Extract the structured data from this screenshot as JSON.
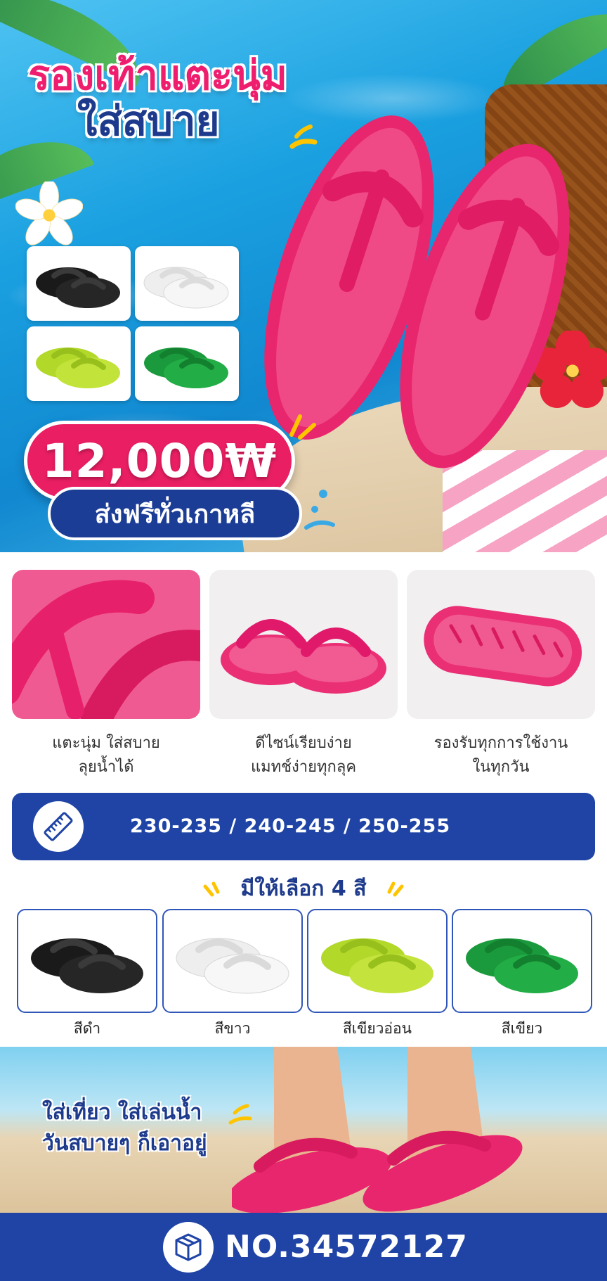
{
  "hero": {
    "title_line1": "รองเท้าแตะนุ่ม",
    "title_line2": "ใส่สบาย",
    "price": "12,000₩",
    "shipping": "ส่งฟรีทั่วเกาหลี"
  },
  "features": [
    {
      "line1": "แตะนุ่ม ใส่สบาย",
      "line2": "ลุยน้ำได้"
    },
    {
      "line1": "ดีไซน์เรียบง่าย",
      "line2": "แมทช์ง่ายทุกลุค"
    },
    {
      "line1": "รองรับทุกการใช้งาน",
      "line2": "ในทุกวัน"
    }
  ],
  "sizes": {
    "text": "230-235  /  240-245  /  250-255",
    "icon": "ruler-icon"
  },
  "colors": {
    "heading": "มีให้เลือก 4 สี",
    "options": [
      {
        "label": "สีดำ",
        "hex": "#1a1a1a"
      },
      {
        "label": "สีขาว",
        "hex": "#f4f4f4"
      },
      {
        "label": "สีเขียวอ่อน",
        "hex": "#b5dc2a"
      },
      {
        "label": "สีเขียว",
        "hex": "#1e9e3e"
      }
    ]
  },
  "banner": {
    "line1": "ใส่เที่ยว ใส่เล่นน้ำ",
    "line2": "วันสบายๆ ก็เอาอยู่"
  },
  "footer": {
    "code": "NO.34572127",
    "icon": "box-icon"
  },
  "theme": {
    "pink": "#e91e63",
    "navy": "#1d3a8c",
    "blue": "#1f44a6"
  }
}
